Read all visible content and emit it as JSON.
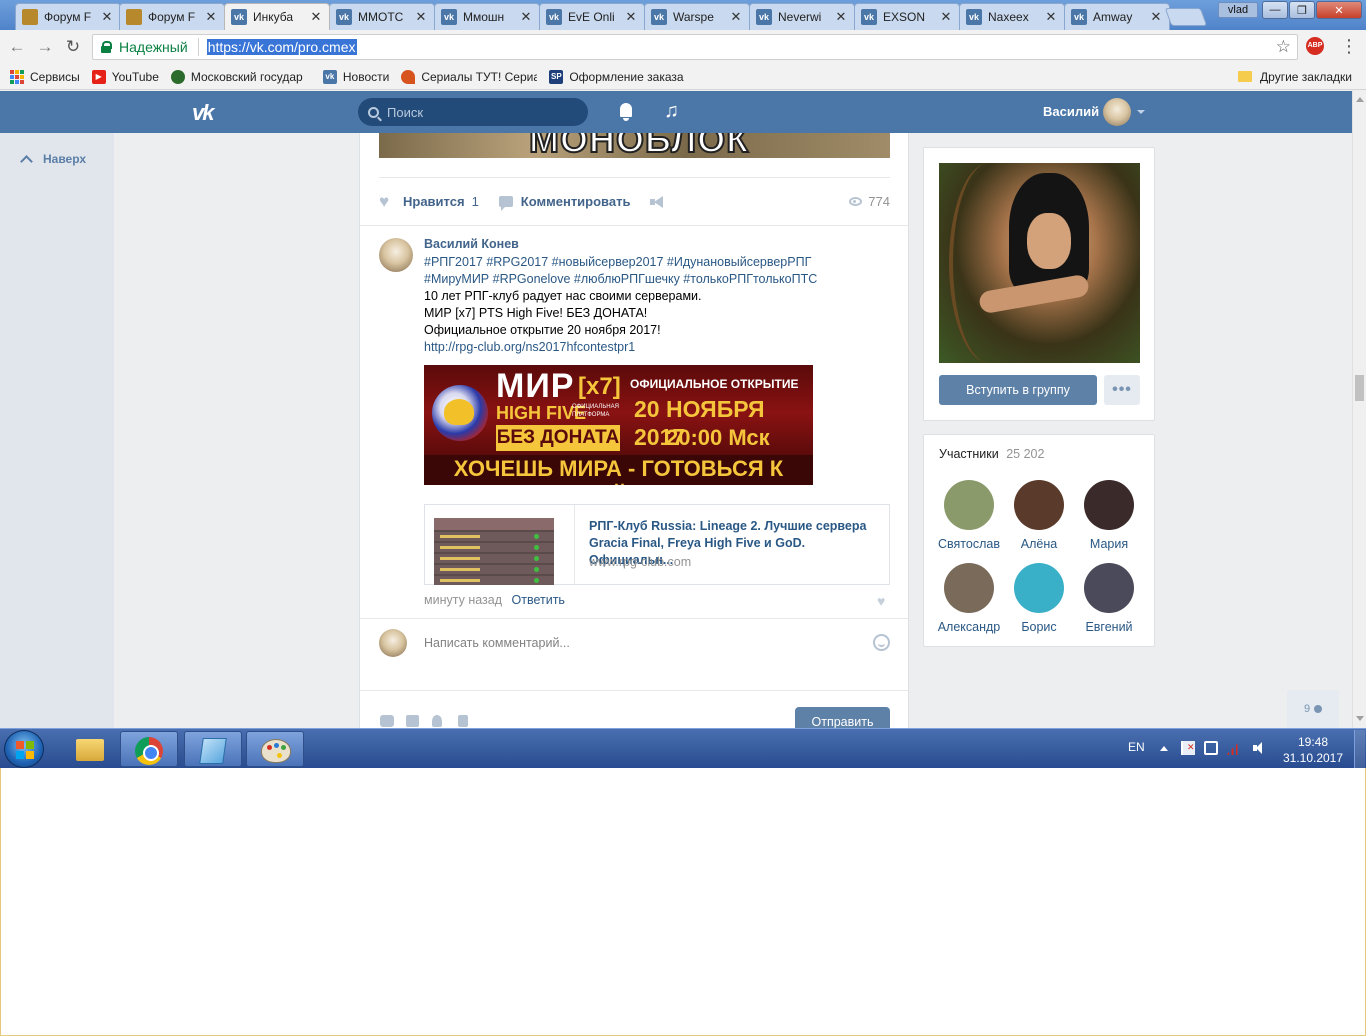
{
  "browser": {
    "tabs": [
      {
        "title": "Форум F",
        "icon": "forum"
      },
      {
        "title": "Форум F",
        "icon": "forum"
      },
      {
        "title": "Инкуба",
        "icon": "vk",
        "active": true
      },
      {
        "title": "MMOTC",
        "icon": "vk"
      },
      {
        "title": "Ммошн",
        "icon": "vk"
      },
      {
        "title": "EvE Onli",
        "icon": "vk"
      },
      {
        "title": "Warspe",
        "icon": "vk"
      },
      {
        "title": "Neverwi",
        "icon": "vk"
      },
      {
        "title": "EXSON",
        "icon": "vk"
      },
      {
        "title": "Naxeex",
        "icon": "vk"
      },
      {
        "title": "Amway",
        "icon": "vk"
      }
    ],
    "tab_close_glyph": "✕",
    "os_user": "vlad",
    "window_buttons": {
      "minimize": "—",
      "maximize": "❐",
      "close": "✕"
    },
    "secure_label": "Надежный",
    "url": "https://vk.com/pro.cmex",
    "bookmarks": [
      {
        "label": "Сервисы",
        "icon": "apps-icon"
      },
      {
        "label": "YouTube",
        "icon": "youtube-icon",
        "color": "#e62117"
      },
      {
        "label": "Московский государ",
        "icon": "msu-icon",
        "color": "#2b6b2b"
      },
      {
        "label": "Новости",
        "icon": "vk-icon",
        "color": "#4a76a8"
      },
      {
        "label": "Сериалы ТУТ! Сериа",
        "icon": "serial-icon",
        "color": "#d8541f"
      },
      {
        "label": "Оформление заказа",
        "icon": "sp-icon",
        "color": "#1f3f7a"
      }
    ],
    "other_bookmarks": "Другие закладки"
  },
  "vk": {
    "colors": {
      "header": "#4a76a8",
      "link": "#2a5885",
      "button": "#5e81a8"
    },
    "logo": "vk",
    "search_placeholder": "Поиск",
    "username": "Василий",
    "to_top": "Наверх",
    "prev_banner_text": "МОНОБЛОК",
    "actions": {
      "like_label": "Нравится",
      "like_count": "1",
      "comment_label": "Комментировать",
      "views": "774"
    },
    "comment": {
      "author": "Василий Конев",
      "hashtags_line1": "#РПГ2017 #RPG2017 #новыйсервер2017 #ИдунановыйсерверРПГ",
      "hashtags_line2": "#МируМИР #RPGonelove #люблюРПГшечку #толькоРПГтолькоПТС",
      "line1": "10 лет РПГ-клуб радует нас своими серверами.",
      "line2": "МИР [x7] PTS High Five! БЕЗ ДОНАТА!",
      "line3": "Официальное открытие 20 ноября 2017!",
      "link": "http://rpg-club.org/ns2017hfcontestpr1",
      "meta_time": "минуту назад",
      "reply": "Ответить"
    },
    "banner": {
      "mir": "МИР",
      "x7": "[x7]",
      "high_five": "HIGH FIVE",
      "platform": "ОФИЦИАЛЬНАЯ ПЛАТФОРМА",
      "no_donate": "БЕЗ ДОНАТА",
      "official": "ОФИЦИАЛЬНОЕ ОТКРЫТИЕ",
      "date": "20 НОЯБРЯ 2017",
      "time": "20:00 Мск",
      "slogan": "ХОЧЕШЬ МИРА - ГОТОВЬСЯ К ВОЙНЕ"
    },
    "link_card": {
      "title": "РПГ-Клуб Russia: Lineage 2. Лучшие сервера Gracia Final, Freya High Five и GoD. Официальн...",
      "domain": "www.rpg-club.com"
    },
    "reply_placeholder": "Написать комментарий...",
    "send": "Отправить",
    "group": {
      "join": "Вступить в группу",
      "more": "•••"
    },
    "members": {
      "title": "Участники",
      "count": "25 202",
      "list": [
        {
          "name": "Святослав",
          "color": "#8a9a6a"
        },
        {
          "name": "Алёна",
          "color": "#5a3a2a"
        },
        {
          "name": "Мария",
          "color": "#3a2a2a"
        },
        {
          "name": "Александр",
          "color": "#7a6a5a"
        },
        {
          "name": "Борис",
          "color": "#3ab0c8"
        },
        {
          "name": "Евгений",
          "color": "#4a4a5a"
        }
      ]
    },
    "online_count": "9"
  },
  "taskbar": {
    "lang": "EN",
    "time": "19:48",
    "date": "31.10.2017"
  }
}
